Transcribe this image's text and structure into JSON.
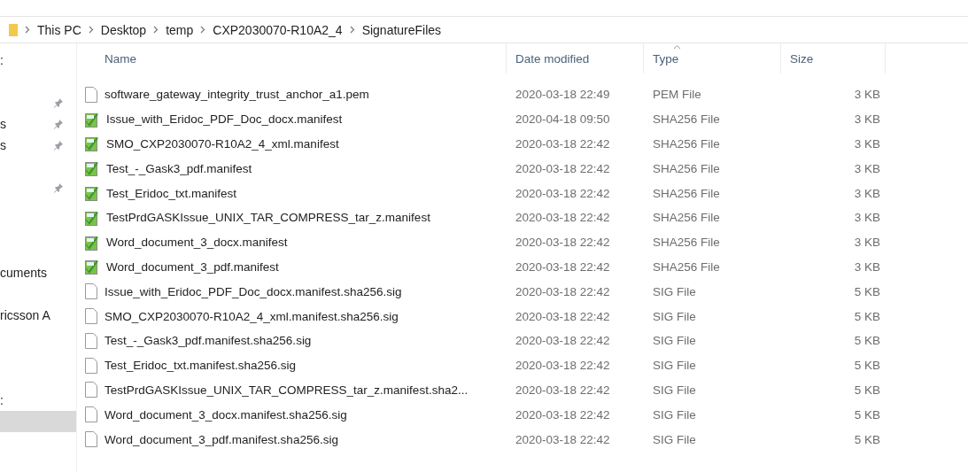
{
  "breadcrumb": [
    "This PC",
    "Desktop",
    "temp",
    "CXP2030070-R10A2_4",
    "SignatureFiles"
  ],
  "sidebar": {
    "items": [
      {
        "kind": "entry",
        "label": ":",
        "pinned": false,
        "selected": false
      },
      {
        "kind": "blank"
      },
      {
        "kind": "entry",
        "pinned": true,
        "selected": false
      },
      {
        "kind": "entry",
        "label": "s",
        "pinned": true,
        "selected": false
      },
      {
        "kind": "entry",
        "label": "s",
        "pinned": true,
        "selected": false
      },
      {
        "kind": "blank"
      },
      {
        "kind": "entry",
        "pinned": true,
        "selected": false
      },
      {
        "kind": "blank"
      },
      {
        "kind": "blank"
      },
      {
        "kind": "blank"
      },
      {
        "kind": "entry",
        "label": "cuments",
        "pinned": false,
        "selected": false
      },
      {
        "kind": "blank"
      },
      {
        "kind": "entry",
        "label": "ricsson A",
        "pinned": false,
        "selected": false
      },
      {
        "kind": "blank"
      },
      {
        "kind": "blank"
      },
      {
        "kind": "blank"
      },
      {
        "kind": "entry",
        "label": ":",
        "pinned": false,
        "selected": false
      },
      {
        "kind": "entry",
        "pinned": false,
        "selected": true
      }
    ]
  },
  "table": {
    "columns": [
      {
        "label": "Name",
        "sorted": false
      },
      {
        "label": "Date modified",
        "sorted": false
      },
      {
        "label": "Type",
        "sorted": true
      },
      {
        "label": "Size",
        "sorted": false
      }
    ],
    "rows": [
      {
        "kind": "plain",
        "name": "software_gateway_integrity_trust_anchor_a1.pem",
        "date": "2020-03-18 22:49",
        "type": "PEM File",
        "size": "3 KB"
      },
      {
        "kind": "manifest",
        "name": "Issue_with_Eridoc_PDF_Doc_docx.manifest",
        "date": "2020-04-18 09:50",
        "type": "SHA256 File",
        "size": "3 KB"
      },
      {
        "kind": "manifest",
        "name": "SMO_CXP2030070-R10A2_4_xml.manifest",
        "date": "2020-03-18 22:42",
        "type": "SHA256 File",
        "size": "3 KB"
      },
      {
        "kind": "manifest",
        "name": "Test_-_Gask3_pdf.manifest",
        "date": "2020-03-18 22:42",
        "type": "SHA256 File",
        "size": "3 KB"
      },
      {
        "kind": "manifest",
        "name": "Test_Eridoc_txt.manifest",
        "date": "2020-03-18 22:42",
        "type": "SHA256 File",
        "size": "3 KB"
      },
      {
        "kind": "manifest",
        "name": "TestPrdGASKIssue_UNIX_TAR_COMPRESS_tar_z.manifest",
        "date": "2020-03-18 22:42",
        "type": "SHA256 File",
        "size": "3 KB"
      },
      {
        "kind": "manifest",
        "name": "Word_document_3_docx.manifest",
        "date": "2020-03-18 22:42",
        "type": "SHA256 File",
        "size": "3 KB"
      },
      {
        "kind": "manifest",
        "name": "Word_document_3_pdf.manifest",
        "date": "2020-03-18 22:42",
        "type": "SHA256 File",
        "size": "3 KB"
      },
      {
        "kind": "plain",
        "name": "Issue_with_Eridoc_PDF_Doc_docx.manifest.sha256.sig",
        "date": "2020-03-18 22:42",
        "type": "SIG File",
        "size": "5 KB"
      },
      {
        "kind": "plain",
        "name": "SMO_CXP2030070-R10A2_4_xml.manifest.sha256.sig",
        "date": "2020-03-18 22:42",
        "type": "SIG File",
        "size": "5 KB"
      },
      {
        "kind": "plain",
        "name": "Test_-_Gask3_pdf.manifest.sha256.sig",
        "date": "2020-03-18 22:42",
        "type": "SIG File",
        "size": "5 KB"
      },
      {
        "kind": "plain",
        "name": "Test_Eridoc_txt.manifest.sha256.sig",
        "date": "2020-03-18 22:42",
        "type": "SIG File",
        "size": "5 KB"
      },
      {
        "kind": "plain",
        "name": "TestPrdGASKIssue_UNIX_TAR_COMPRESS_tar_z.manifest.sha2...",
        "date": "2020-03-18 22:42",
        "type": "SIG File",
        "size": "5 KB"
      },
      {
        "kind": "plain",
        "name": "Word_document_3_docx.manifest.sha256.sig",
        "date": "2020-03-18 22:42",
        "type": "SIG File",
        "size": "5 KB"
      },
      {
        "kind": "plain",
        "name": "Word_document_3_pdf.manifest.sha256.sig",
        "date": "2020-03-18 22:42",
        "type": "SIG File",
        "size": "5 KB"
      }
    ]
  }
}
